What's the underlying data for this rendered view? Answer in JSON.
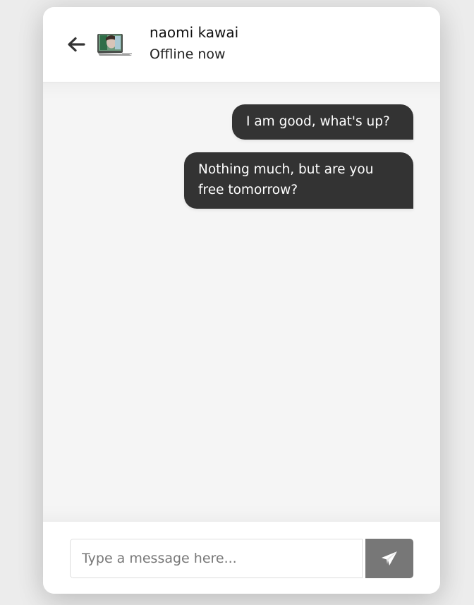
{
  "header": {
    "back_icon": "arrow-left-icon",
    "user_name": "naomi kawai",
    "status": "Offline now"
  },
  "messages": [
    {
      "direction": "outgoing",
      "text": "I am good, what's up?"
    },
    {
      "direction": "outgoing",
      "text": "Nothing much, but are you free tomorrow?"
    }
  ],
  "input": {
    "value": "",
    "placeholder": "Type a message here..."
  },
  "send_button": {
    "icon": "paper-plane-icon"
  },
  "colors": {
    "background": "#ececec",
    "card": "#ffffff",
    "chat_background": "#f5f5f5",
    "bubble": "#333333",
    "bubble_text": "#ffffff",
    "send_button": "#777777"
  }
}
